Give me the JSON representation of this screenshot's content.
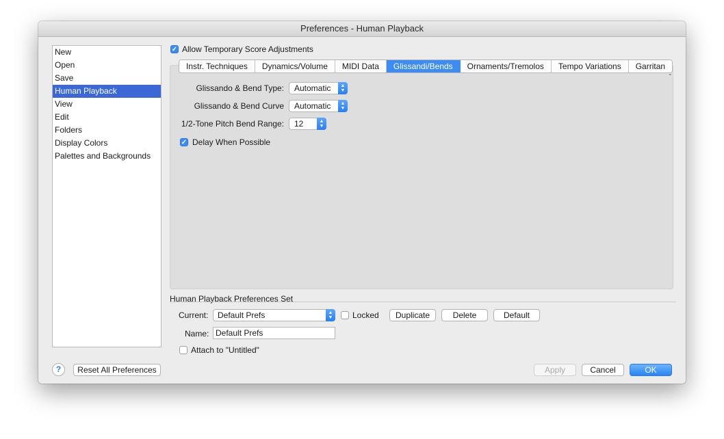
{
  "window": {
    "title": "Preferences - Human Playback"
  },
  "sidebar": {
    "items": [
      {
        "label": "New"
      },
      {
        "label": "Open"
      },
      {
        "label": "Save"
      },
      {
        "label": "Human Playback"
      },
      {
        "label": "View"
      },
      {
        "label": "Edit"
      },
      {
        "label": "Folders"
      },
      {
        "label": "Display Colors"
      },
      {
        "label": "Palettes and Backgrounds"
      }
    ],
    "selected": "Human Playback"
  },
  "allow_temp": {
    "label": "Allow Temporary Score Adjustments",
    "checked": true
  },
  "tabs": {
    "items": [
      {
        "label": "Instr. Techniques"
      },
      {
        "label": "Dynamics/Volume"
      },
      {
        "label": "MIDI Data"
      },
      {
        "label": "Glissandi/Bends"
      },
      {
        "label": "Ornaments/Tremolos"
      },
      {
        "label": "Tempo Variations"
      },
      {
        "label": "Garritan"
      }
    ],
    "active": "Glissandi/Bends"
  },
  "glissandi": {
    "type_label": "Glissando & Bend Type:",
    "type_value": "Automatic",
    "curve_label": "Glissando & Bend Curve",
    "curve_value": "Automatic",
    "range_label": "1/2-Tone Pitch Bend Range:",
    "range_value": "12",
    "delay_label": "Delay When Possible",
    "delay_checked": true,
    "panel_mark": "-"
  },
  "prefs_set": {
    "heading": "Human Playback Preferences Set",
    "current_label": "Current:",
    "current_value": "Default Prefs",
    "locked_label": "Locked",
    "locked_checked": false,
    "duplicate_label": "Duplicate",
    "delete_label": "Delete",
    "default_label": "Default",
    "name_label": "Name:",
    "name_value": "Default Prefs",
    "attach_label": "Attach to \"Untitled\"",
    "attach_checked": false
  },
  "footer": {
    "help_glyph": "?",
    "reset_label": "Reset All Preferences",
    "apply_label": "Apply",
    "cancel_label": "Cancel",
    "ok_label": "OK"
  },
  "colors": {
    "accent": "#3c8cf3",
    "sidebar_selection": "#3b68d6",
    "window_bg": "#ececec",
    "panel_bg": "#dedede"
  }
}
